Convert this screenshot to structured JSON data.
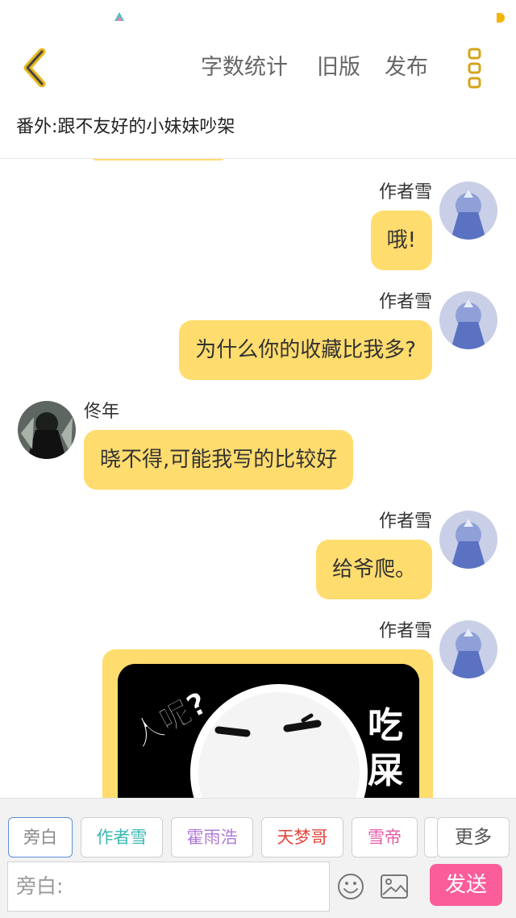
{
  "top_bar": {
    "actions": [
      "字数统计",
      "旧版",
      "发布"
    ]
  },
  "chapter": {
    "title": "番外:跟不友好的小妹妹吵架"
  },
  "messages": [
    {
      "sender": "作者雪",
      "side": "right",
      "text": "哦!"
    },
    {
      "sender": "作者雪",
      "side": "right",
      "text": "为什么你的收藏比我多?"
    },
    {
      "sender": "佟年",
      "side": "left",
      "text": "晓不得,可能我写的比较好"
    },
    {
      "sender": "作者雪",
      "side": "right",
      "text": "给爷爬。"
    },
    {
      "sender": "作者雪",
      "side": "right",
      "sticker_text": [
        "人呢?",
        "吃",
        "屎"
      ]
    }
  ],
  "roles": {
    "items": [
      {
        "label": "旁白",
        "color": "#888888",
        "active": true
      },
      {
        "label": "作者雪",
        "color": "#3cb8b2",
        "active": false
      },
      {
        "label": "霍雨浩",
        "color": "#b07ad6",
        "active": false
      },
      {
        "label": "天梦哥",
        "color": "#e2483f",
        "active": false
      },
      {
        "label": "雪帝",
        "color": "#e25aa6",
        "active": false
      }
    ],
    "more_label": "更多"
  },
  "composer": {
    "placeholder": "旁白:",
    "send_label": "发送"
  },
  "colors": {
    "bubble": "#ffdc6e",
    "send": "#fb5d9a",
    "accent": "#e8b830"
  }
}
